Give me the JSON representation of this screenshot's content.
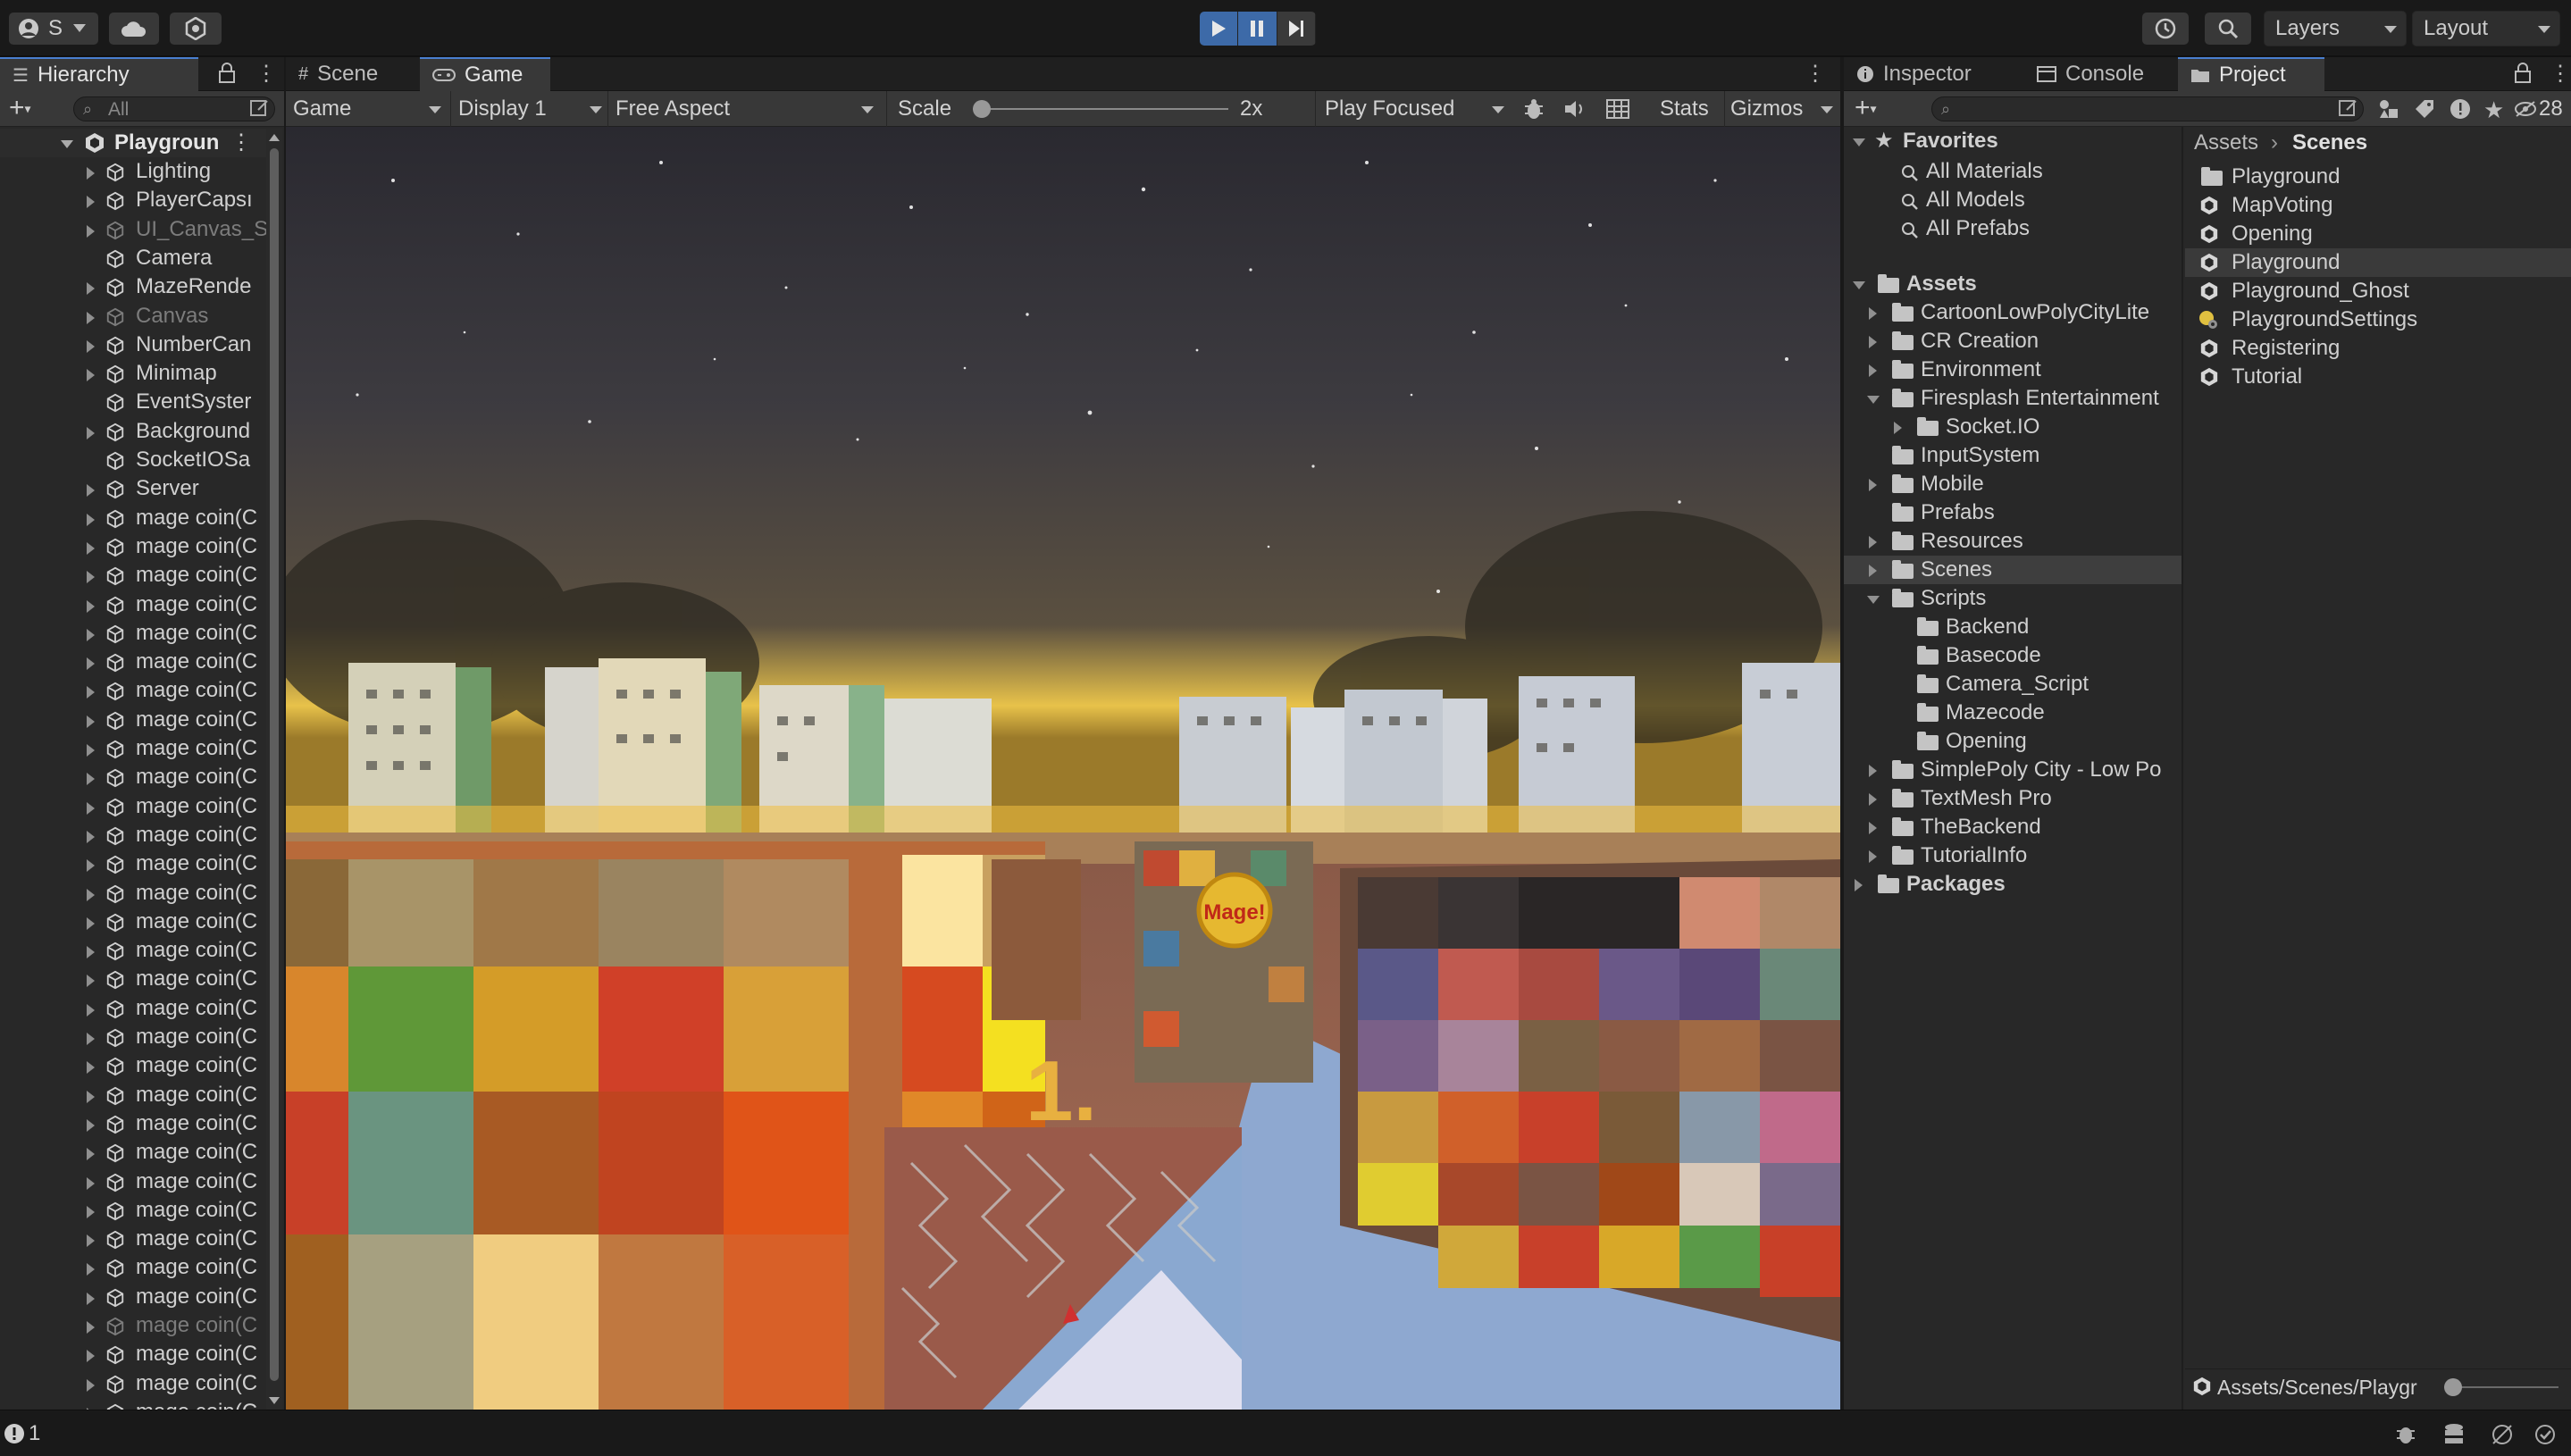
{
  "topbar": {
    "account_label": "S",
    "layers_label": "Layers",
    "layout_label": "Layout"
  },
  "hierarchy": {
    "tab_label": "Hierarchy",
    "search_placeholder": "All",
    "root": "Playgroun",
    "items": [
      {
        "label": "Lighting",
        "expandable": true,
        "dim": false
      },
      {
        "label": "PlayerCapsı",
        "expandable": true,
        "dim": false
      },
      {
        "label": "UI_Canvas_S",
        "expandable": true,
        "dim": true
      },
      {
        "label": "Camera",
        "expandable": false,
        "dim": false
      },
      {
        "label": "MazeRende",
        "expandable": true,
        "dim": false
      },
      {
        "label": "Canvas",
        "expandable": true,
        "dim": true
      },
      {
        "label": "NumberCan",
        "expandable": true,
        "dim": false
      },
      {
        "label": "Minimap",
        "expandable": true,
        "dim": false
      },
      {
        "label": "EventSyster",
        "expandable": false,
        "dim": false
      },
      {
        "label": "Background",
        "expandable": true,
        "dim": false
      },
      {
        "label": "SocketIOSa",
        "expandable": false,
        "dim": false
      },
      {
        "label": "Server",
        "expandable": true,
        "dim": false
      },
      {
        "label": "mage coin(C",
        "expandable": true,
        "dim": false
      },
      {
        "label": "mage coin(C",
        "expandable": true,
        "dim": false
      },
      {
        "label": "mage coin(C",
        "expandable": true,
        "dim": false
      },
      {
        "label": "mage coin(C",
        "expandable": true,
        "dim": false
      },
      {
        "label": "mage coin(C",
        "expandable": true,
        "dim": false
      },
      {
        "label": "mage coin(C",
        "expandable": true,
        "dim": false
      },
      {
        "label": "mage coin(C",
        "expandable": true,
        "dim": false
      },
      {
        "label": "mage coin(C",
        "expandable": true,
        "dim": false
      },
      {
        "label": "mage coin(C",
        "expandable": true,
        "dim": false
      },
      {
        "label": "mage coin(C",
        "expandable": true,
        "dim": false
      },
      {
        "label": "mage coin(C",
        "expandable": true,
        "dim": false
      },
      {
        "label": "mage coin(C",
        "expandable": true,
        "dim": false
      },
      {
        "label": "mage coin(C",
        "expandable": true,
        "dim": false
      },
      {
        "label": "mage coin(C",
        "expandable": true,
        "dim": false
      },
      {
        "label": "mage coin(C",
        "expandable": true,
        "dim": false
      },
      {
        "label": "mage coin(C",
        "expandable": true,
        "dim": false
      },
      {
        "label": "mage coin(C",
        "expandable": true,
        "dim": false
      },
      {
        "label": "mage coin(C",
        "expandable": true,
        "dim": false
      },
      {
        "label": "mage coin(C",
        "expandable": true,
        "dim": false
      },
      {
        "label": "mage coin(C",
        "expandable": true,
        "dim": false
      },
      {
        "label": "mage coin(C",
        "expandable": true,
        "dim": false
      },
      {
        "label": "mage coin(C",
        "expandable": true,
        "dim": false
      },
      {
        "label": "mage coin(C",
        "expandable": true,
        "dim": false
      },
      {
        "label": "mage coin(C",
        "expandable": true,
        "dim": false
      },
      {
        "label": "mage coin(C",
        "expandable": true,
        "dim": false
      },
      {
        "label": "mage coin(C",
        "expandable": true,
        "dim": false
      },
      {
        "label": "mage coin(C",
        "expandable": true,
        "dim": false
      },
      {
        "label": "mage coin(C",
        "expandable": true,
        "dim": false
      },
      {
        "label": "mage coin(C",
        "expandable": true,
        "dim": true
      },
      {
        "label": "mage coin(C",
        "expandable": true,
        "dim": false
      },
      {
        "label": "mage coin(C",
        "expandable": true,
        "dim": false
      },
      {
        "label": "mage coin(C",
        "expandable": true,
        "dim": false
      }
    ]
  },
  "game_view": {
    "tabs": [
      "Scene",
      "Game"
    ],
    "mode": "Game",
    "display": "Display 1",
    "aspect": "Free Aspect",
    "scale_label": "Scale",
    "scale_value": "2x",
    "play_focused": "Play Focused",
    "stats": "Stats",
    "gizmos": "Gizmos",
    "coin_text": "Mage!",
    "hud_number": "1."
  },
  "right_panel": {
    "tabs": [
      "Inspector",
      "Console",
      "Project"
    ],
    "hidden_count": "28",
    "favorites_label": "Favorites",
    "favorites": [
      "All Materials",
      "All Models",
      "All Prefabs"
    ],
    "assets_label": "Assets",
    "assets_tree": [
      {
        "label": "CartoonLowPolyCityLite",
        "depth": 1,
        "arrow": "right"
      },
      {
        "label": "CR Creation",
        "depth": 1,
        "arrow": "right"
      },
      {
        "label": "Environment",
        "depth": 1,
        "arrow": "right"
      },
      {
        "label": "Firesplash Entertainment",
        "depth": 1,
        "arrow": "down"
      },
      {
        "label": "Socket.IO",
        "depth": 2,
        "arrow": "right"
      },
      {
        "label": "InputSystem",
        "depth": 1,
        "arrow": "none"
      },
      {
        "label": "Mobile",
        "depth": 1,
        "arrow": "right"
      },
      {
        "label": "Prefabs",
        "depth": 1,
        "arrow": "none"
      },
      {
        "label": "Resources",
        "depth": 1,
        "arrow": "right"
      },
      {
        "label": "Scenes",
        "depth": 1,
        "arrow": "right",
        "selected": true
      },
      {
        "label": "Scripts",
        "depth": 1,
        "arrow": "down"
      },
      {
        "label": "Backend",
        "depth": 2,
        "arrow": "none"
      },
      {
        "label": "Basecode",
        "depth": 2,
        "arrow": "none"
      },
      {
        "label": "Camera_Script",
        "depth": 2,
        "arrow": "none"
      },
      {
        "label": "Mazecode",
        "depth": 2,
        "arrow": "none"
      },
      {
        "label": "Opening",
        "depth": 2,
        "arrow": "none"
      },
      {
        "label": "SimplePoly City - Low Po",
        "depth": 1,
        "arrow": "right"
      },
      {
        "label": "TextMesh Pro",
        "depth": 1,
        "arrow": "right"
      },
      {
        "label": "TheBackend",
        "depth": 1,
        "arrow": "right"
      },
      {
        "label": "TutorialInfo",
        "depth": 1,
        "arrow": "right"
      }
    ],
    "packages_label": "Packages",
    "breadcrumb": [
      "Assets",
      "Scenes"
    ],
    "files": [
      {
        "label": "Playground",
        "kind": "folder"
      },
      {
        "label": "MapVoting",
        "kind": "scene"
      },
      {
        "label": "Opening",
        "kind": "scene"
      },
      {
        "label": "Playground",
        "kind": "scene",
        "selected": true
      },
      {
        "label": "Playground_Ghost",
        "kind": "scene"
      },
      {
        "label": "PlaygroundSettings",
        "kind": "settings"
      },
      {
        "label": "Registering",
        "kind": "scene"
      },
      {
        "label": "Tutorial",
        "kind": "scene"
      }
    ],
    "footer_path": "Assets/Scenes/Playgr"
  },
  "statusbar": {
    "count": "1"
  },
  "colors": {
    "accent": "#3d6aa8",
    "panel": "#282828",
    "toolbar": "#383838"
  }
}
